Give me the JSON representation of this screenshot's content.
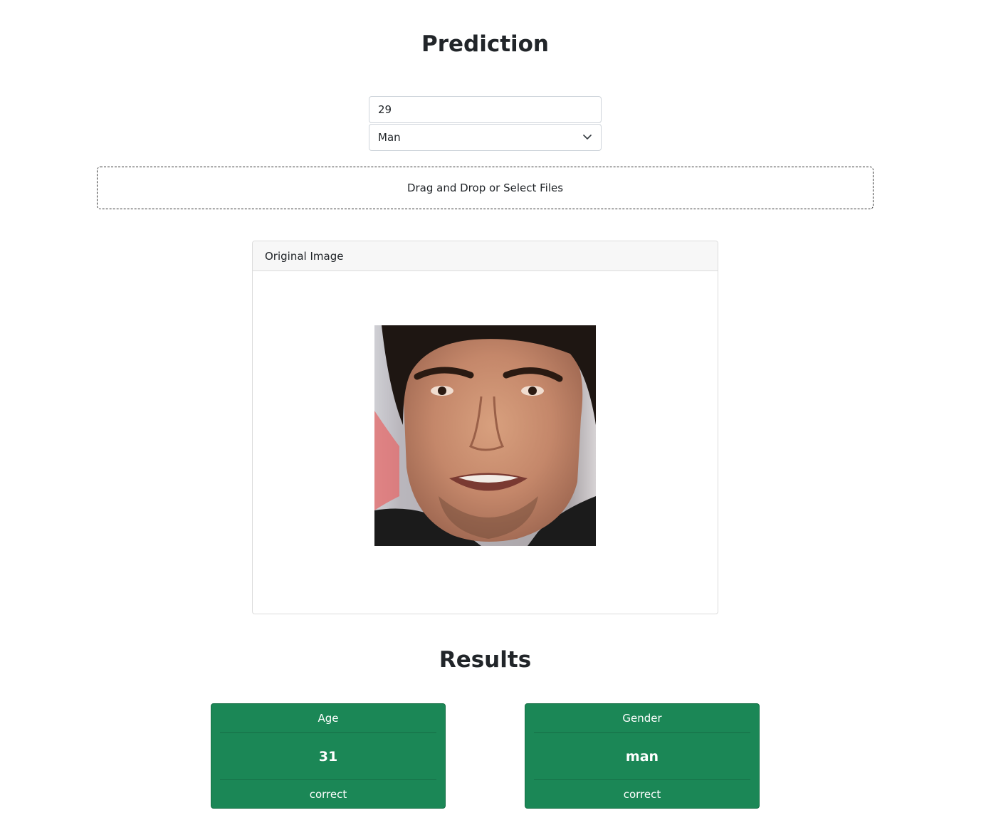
{
  "header": {
    "title": "Prediction"
  },
  "form": {
    "age_value": "29",
    "gender_selected": "Man",
    "upload_label": "Drag and Drop or Select Files"
  },
  "image_card": {
    "header": "Original Image"
  },
  "results": {
    "title": "Results",
    "cards": [
      {
        "label": "Age",
        "value": "31",
        "status": "correct"
      },
      {
        "label": "Gender",
        "value": "man",
        "status": "correct"
      }
    ],
    "card_color": "#1b8756"
  },
  "icons": {
    "select_chevron": "chevron-down-icon"
  }
}
